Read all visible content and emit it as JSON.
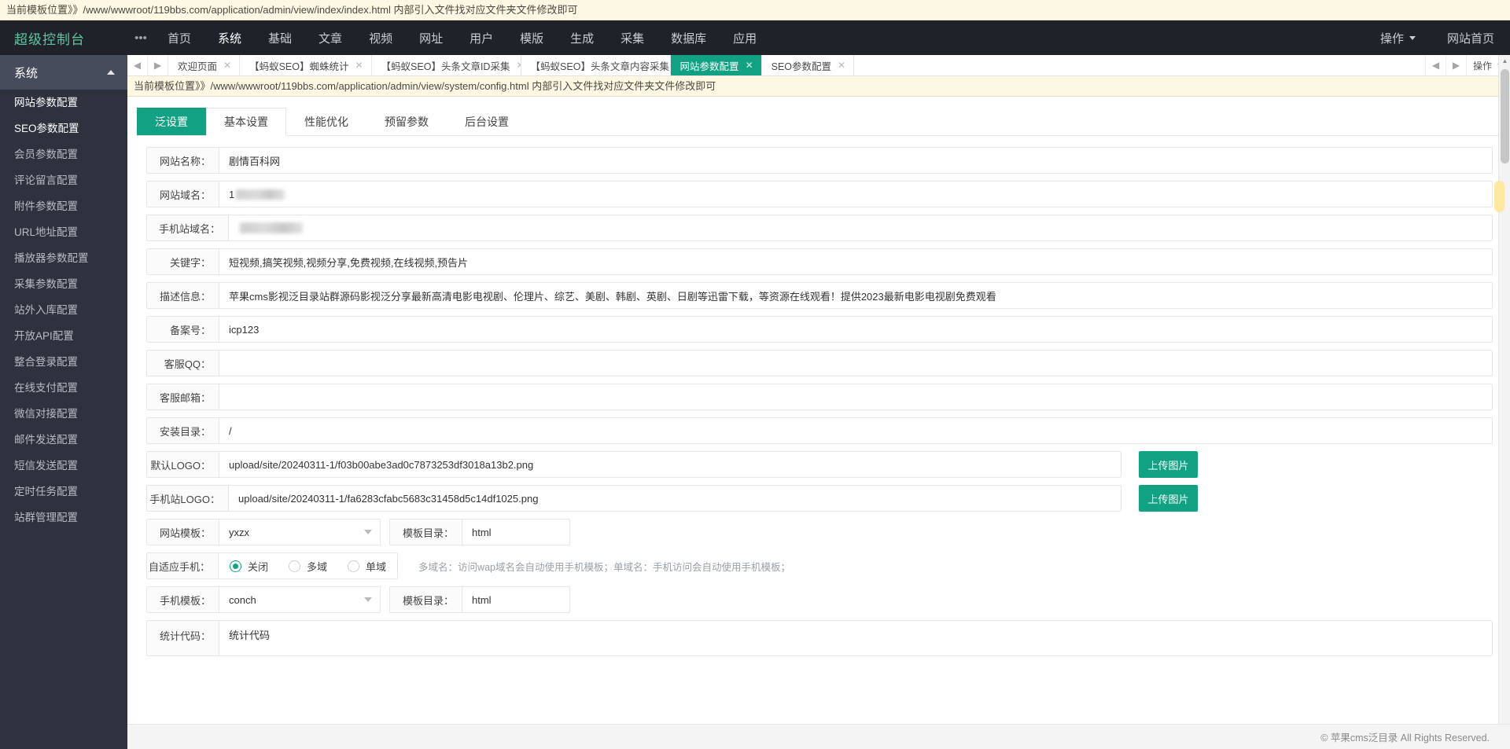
{
  "top_template_path": "当前模板位置》》/www/wwwroot/119bbs.com/application/admin/view/index/index.html 内部引入文件找对应文件夹文件修改即可",
  "header": {
    "brand": "超级控制台",
    "dots": "•••",
    "nav": [
      {
        "label": "首页",
        "active": false
      },
      {
        "label": "系统",
        "active": true
      },
      {
        "label": "基础",
        "active": false
      },
      {
        "label": "文章",
        "active": false
      },
      {
        "label": "视频",
        "active": false
      },
      {
        "label": "网址",
        "active": false
      },
      {
        "label": "用户",
        "active": false
      },
      {
        "label": "模版",
        "active": false
      },
      {
        "label": "生成",
        "active": false
      },
      {
        "label": "采集",
        "active": false
      },
      {
        "label": "数据库",
        "active": false
      },
      {
        "label": "应用",
        "active": false
      }
    ],
    "right": [
      {
        "label": "操作",
        "caret": true
      },
      {
        "label": "网站首页",
        "caret": false
      }
    ]
  },
  "sidebar": {
    "title": "系统",
    "items": [
      {
        "label": "网站参数配置",
        "strong": true
      },
      {
        "label": "SEO参数配置",
        "strong": true
      },
      {
        "label": "会员参数配置",
        "strong": false
      },
      {
        "label": "评论留言配置",
        "strong": false
      },
      {
        "label": "附件参数配置",
        "strong": false
      },
      {
        "label": "URL地址配置",
        "strong": false
      },
      {
        "label": "播放器参数配置",
        "strong": false
      },
      {
        "label": "采集参数配置",
        "strong": false
      },
      {
        "label": "站外入库配置",
        "strong": false
      },
      {
        "label": "开放API配置",
        "strong": false
      },
      {
        "label": "整合登录配置",
        "strong": false
      },
      {
        "label": "在线支付配置",
        "strong": false
      },
      {
        "label": "微信对接配置",
        "strong": false
      },
      {
        "label": "邮件发送配置",
        "strong": false
      },
      {
        "label": "短信发送配置",
        "strong": false
      },
      {
        "label": "定时任务配置",
        "strong": false
      },
      {
        "label": "站群管理配置",
        "strong": false
      }
    ]
  },
  "tabstrip": {
    "tabs": [
      {
        "label": "欢迎页面",
        "active": false
      },
      {
        "label": "【蚂蚁SEO】蜘蛛统计",
        "active": false
      },
      {
        "label": "【蚂蚁SEO】头条文章ID采集",
        "active": false
      },
      {
        "label": "【蚂蚁SEO】头条文章内容采集",
        "active": false
      },
      {
        "label": "网站参数配置",
        "active": true
      },
      {
        "label": "SEO参数配置",
        "active": false
      }
    ],
    "menu_label": "操作"
  },
  "inner_template_path": "当前模板位置》》/www/wwwroot/119bbs.com/application/admin/view/system/config.html 内部引入文件找对应文件夹文件修改即可",
  "form_tabs": [
    {
      "label": "泛设置",
      "active": true
    },
    {
      "label": "基本设置",
      "active": false
    },
    {
      "label": "性能优化",
      "active": false
    },
    {
      "label": "预留参数",
      "active": false
    },
    {
      "label": "后台设置",
      "active": false
    }
  ],
  "form": {
    "site_name": {
      "label": "网站名称：",
      "value": "剧情百科网"
    },
    "site_domain": {
      "label": "网站域名：",
      "value": "1",
      "redacted": true
    },
    "mobile_domain": {
      "label": "手机站域名：",
      "value": "119bb",
      "redacted": true
    },
    "keywords": {
      "label": "关键字：",
      "value": "短视频,搞笑视频,视频分享,免费视频,在线视频,预告片"
    },
    "description": {
      "label": "描述信息：",
      "value": "苹果cms影视泛目录站群源码影视泛分享最新高清电影电视剧、伦理片、综艺、美剧、韩剧、英剧、日剧等迅雷下载，等资源在线观看！提供2023最新电影电视剧免费观看"
    },
    "icp": {
      "label": "备案号：",
      "value": "icp123"
    },
    "service_qq": {
      "label": "客服QQ：",
      "value": ""
    },
    "service_email": {
      "label": "客服邮箱：",
      "value": ""
    },
    "install_dir": {
      "label": "安装目录：",
      "value": "/"
    },
    "default_logo": {
      "label": "默认LOGO：",
      "value": "upload/site/20240311-1/f03b00abe3ad0c7873253df3018a13b2.png",
      "button": "上传图片"
    },
    "mobile_logo": {
      "label": "手机站LOGO：",
      "value": "upload/site/20240311-1/fa6283cfabc5683c31458d5c14df1025.png",
      "button": "上传图片"
    },
    "site_template": {
      "label": "网站模板：",
      "value": "yxzx"
    },
    "template_dir": {
      "label": "模板目录：",
      "value": "html"
    },
    "adaptive_mobile": {
      "label": "自适应手机：",
      "options": [
        {
          "label": "关闭",
          "checked": true
        },
        {
          "label": "多域",
          "checked": false
        },
        {
          "label": "单域",
          "checked": false
        }
      ],
      "hint": "多域名：访问wap域名会自动使用手机模板；单域名：手机访问会自动使用手机模板；"
    },
    "mobile_template": {
      "label": "手机模板：",
      "value": "conch"
    },
    "mobile_template_dir": {
      "label": "模板目录：",
      "value": "html"
    },
    "stats_code": {
      "label": "统计代码：",
      "value": "统计代码"
    }
  },
  "footer": "© 苹果cms泛目录 All Rights Reserved.",
  "colors": {
    "accent": "#12a182",
    "header_bg": "#20222a",
    "sidebar_bg": "#2e323e",
    "brand": "#5cc79e",
    "notice_bg": "#fdf8e3"
  }
}
